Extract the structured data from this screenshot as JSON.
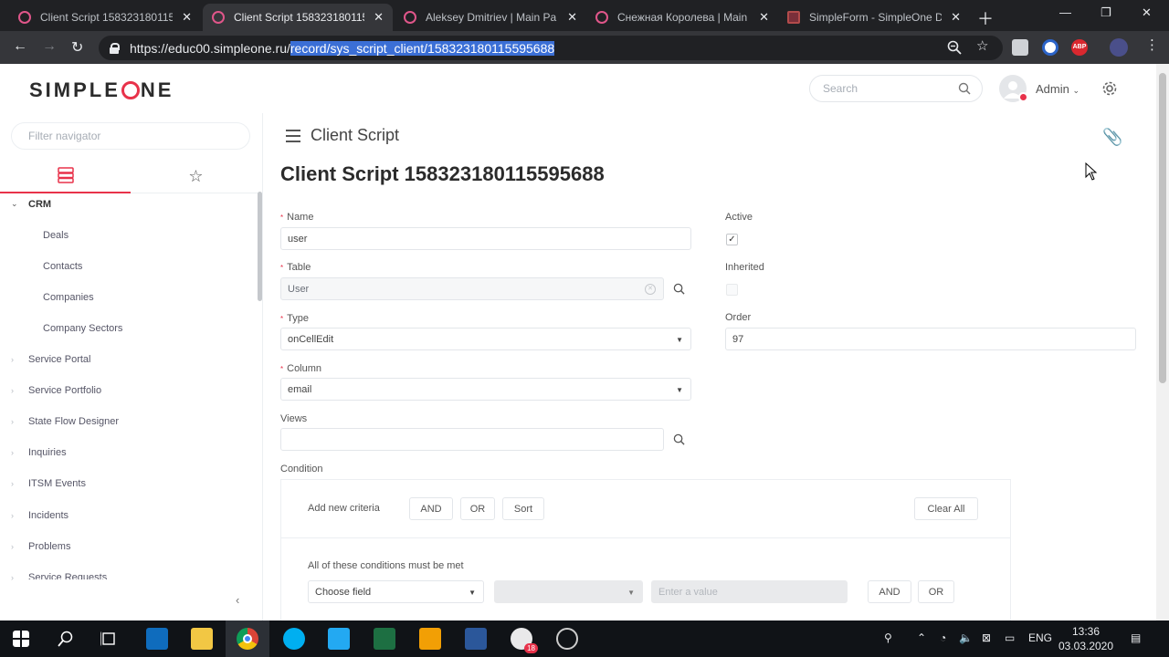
{
  "browser": {
    "tabs": [
      {
        "title": "Client Script 158323180115",
        "active": false
      },
      {
        "title": "Client Script 1583231801159",
        "active": true
      },
      {
        "title": "Aleksey Dmitriev | Main Pa",
        "active": false
      },
      {
        "title": "Снежная Королева | Main",
        "active": false
      },
      {
        "title": "SimpleForm - SimpleOne D",
        "active": false
      }
    ],
    "url_host": "https://educ00.simpleone.ru/",
    "url_path": "record/sys_script_client/158323180115595688",
    "close_glyph": "✕"
  },
  "header": {
    "logo_before": "SIMPLE",
    "logo_after": "NE",
    "search_placeholder": "Search",
    "user_name": "Admin"
  },
  "sidebar": {
    "filter_placeholder": "Filter navigator",
    "items": [
      {
        "label": "CRM",
        "level": "top",
        "expanded": true
      },
      {
        "label": "Deals",
        "level": "sub"
      },
      {
        "label": "Contacts",
        "level": "sub"
      },
      {
        "label": "Companies",
        "level": "sub"
      },
      {
        "label": "Company Sectors",
        "level": "sub"
      },
      {
        "label": "Service Portal",
        "level": "top"
      },
      {
        "label": "Service Portfolio",
        "level": "top"
      },
      {
        "label": "State Flow Designer",
        "level": "top"
      },
      {
        "label": "Inquiries",
        "level": "top"
      },
      {
        "label": "ITSM Events",
        "level": "top"
      },
      {
        "label": "Incidents",
        "level": "top"
      },
      {
        "label": "Problems",
        "level": "top"
      },
      {
        "label": "Service Requests",
        "level": "top"
      }
    ]
  },
  "main": {
    "breadcrumb": "Client Script",
    "title": "Client Script 158323180115595688",
    "fields": {
      "name_label": "Name",
      "name_value": "user",
      "table_label": "Table",
      "table_value": "User",
      "type_label": "Type",
      "type_value": "onCellEdit",
      "column_label": "Column",
      "column_value": "email",
      "views_label": "Views",
      "views_value": "",
      "active_label": "Active",
      "active_checked": true,
      "inherited_label": "Inherited",
      "inherited_checked": false,
      "order_label": "Order",
      "order_value": "97",
      "condition_label": "Condition"
    },
    "condition": {
      "add_criteria": "Add new criteria",
      "and": "AND",
      "or": "OR",
      "sort": "Sort",
      "clear_all": "Clear All",
      "must_be_met": "All of these conditions must be met",
      "choose_field": "Choose field",
      "enter_value_placeholder": "Enter a value",
      "row_and": "AND",
      "row_or": "OR"
    }
  },
  "taskbar": {
    "language": "ENG",
    "time": "13:36",
    "date": "03.03.2020",
    "vscode_badge": "18"
  }
}
